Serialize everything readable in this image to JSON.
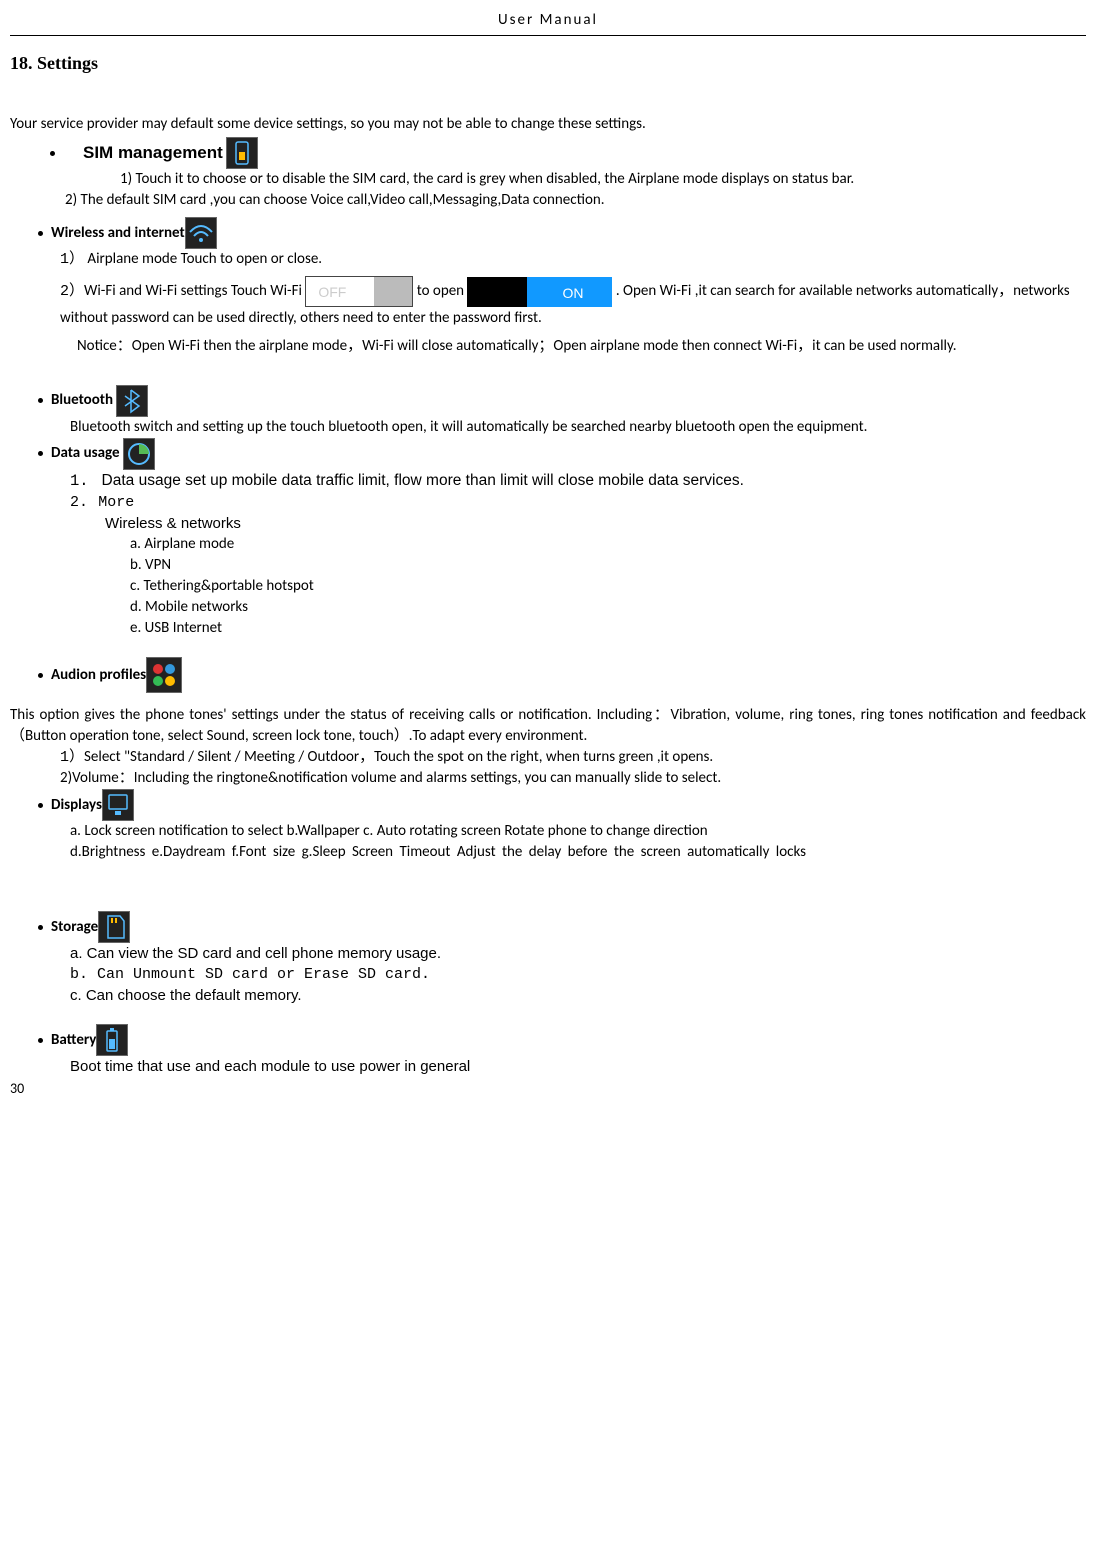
{
  "header": "User    Manual",
  "chapter_title": "18. Settings",
  "intro": "Your service provider may default some device settings, so you may not be able to change these settings.",
  "sim": {
    "title": "SIM management",
    "item1": "1) Touch it to choose or to disable the SIM card, the card is grey when disabled, the Airplane mode displays on status bar.",
    "item2": "2) The default SIM card ,you can choose Voice call,Video call,Messaging,Data connection."
  },
  "wireless": {
    "title": "Wireless and internet",
    "airplane_num": "1）",
    "airplane": "Airplane mode      Touch to open or close.",
    "wifi_num": "2）",
    "wifi_a": "Wi-Fi and Wi-Fi settings        Touch Wi-Fi ",
    "wifi_b": " to open ",
    "wifi_c": ". Open Wi-Fi ,it can search for available networks automatically，networks without password can be used directly, others need to enter the password    first.",
    "notice": "Notice：Open Wi-Fi then the airplane mode，Wi-Fi will close automatically；Open airplane mode then connect Wi-Fi，it can be used normally.",
    "off_label": "OFF",
    "on_label": "ON"
  },
  "bt": {
    "title": "Bluetooth",
    "body": "Bluetooth switch and setting up the touch bluetooth open, it will automatically be searched nearby bluetooth open the equipment."
  },
  "data": {
    "title": "Data usage",
    "num1": "1.",
    "item1": "Data usage    set up mobile data traffic limit, flow more than limit will close mobile data services.",
    "num2": "2.",
    "more": "More",
    "sub_title": "Wireless & networks",
    "a": "a.    Airplane mode",
    "b": "b.    VPN",
    "c": "c.    Tethering&portable hotspot",
    "d": "d.    Mobile networks",
    "e": "e.    USB Internet"
  },
  "audio": {
    "title": "Audion profiles",
    "body": "This option gives the phone tones' settings under the status of receiving calls or notification. Including：Vibration, volume, ring tones, ring tones notification and feedback（Button operation tone, select Sound, screen lock tone, touch）.To adapt every environment.",
    "num1": "1）",
    "item1": "Select   \"Standard / Silent / Meeting / Outdoor，Touch the spot on the right, when turns green ,it opens.",
    "item2": "2)Volume：Including the ringtone&notification volume and alarms settings, you can manually slide to select."
  },
  "displays": {
    "title": "Displays",
    "line1": "a. Lock screen notification to select    b.Wallpaper      c. Auto rotating screen    Rotate    phone to change direction",
    "line2": "d.Brightness e.Daydream f.Font size g.Sleep Screen Timeout   Adjust the delay before the screen automatically locks"
  },
  "storage": {
    "title": "Storage",
    "a": "a.    Can view the SD card and cell phone memory usage.",
    "b": "b.  Can Unmount SD card or Erase SD card.",
    "c": "c.    Can choose the default memory."
  },
  "battery": {
    "title": "Battery",
    "body": "Boot time that use and each module to use power in general"
  },
  "page_num": "30"
}
